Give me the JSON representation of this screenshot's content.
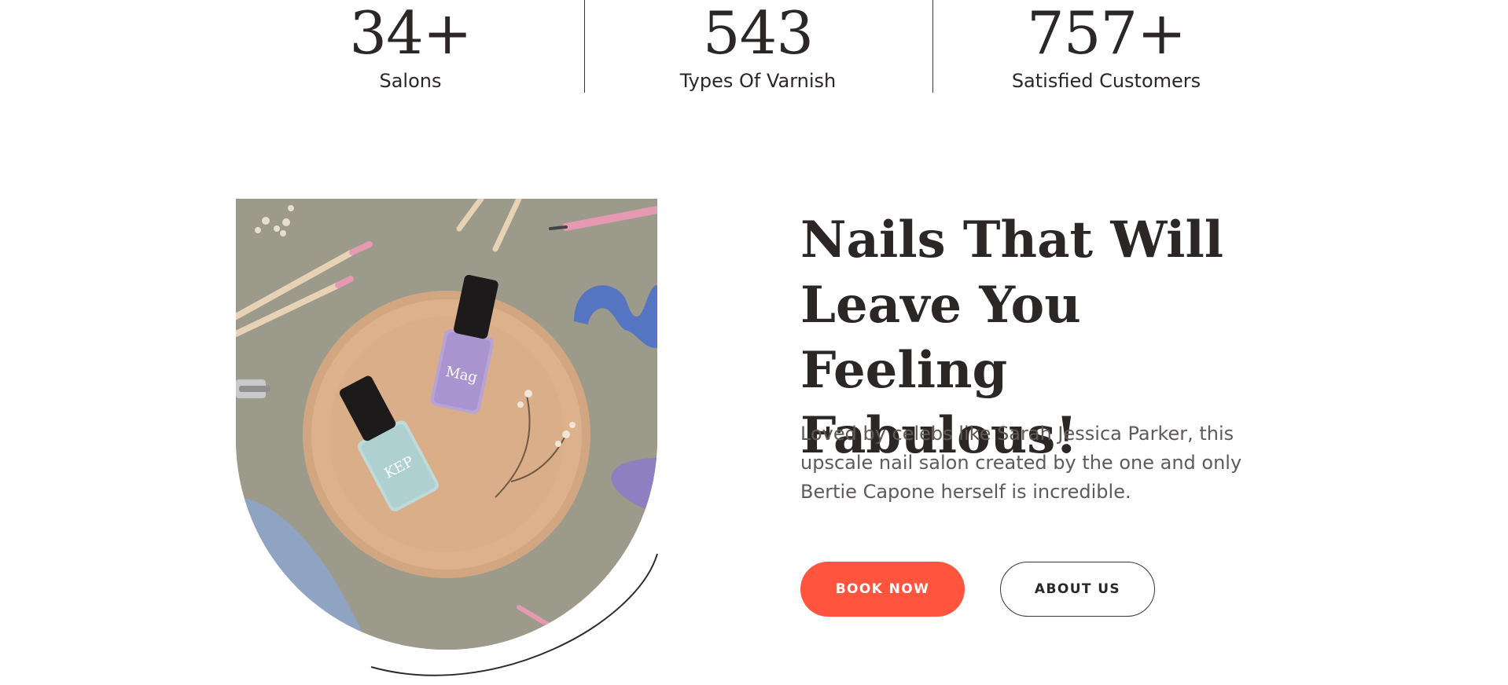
{
  "stats": [
    {
      "number": "34+",
      "label": "Salons"
    },
    {
      "number": "543",
      "label": "Types Of Varnish"
    },
    {
      "number": "757+",
      "label": "Satisfied Customers"
    }
  ],
  "hero": {
    "heading_line1": "Nails That Will",
    "heading_line2": "Leave You Feeling",
    "heading_line3": "Fabulous!",
    "description": "Loved by celebs like Sarah Jessica Parker, this upscale nail salon created by the one and only Bertie Capone herself is incredible.",
    "book_button": "BOOK NOW",
    "about_button": "ABOUT US"
  },
  "image": {
    "polish_label_purple": "Mag",
    "polish_label_mint": "KEP"
  },
  "colors": {
    "accent": "#ff553e",
    "text_dark": "#2b2726",
    "text_muted": "#5f5a59",
    "photo_background": "#9c9a8b"
  }
}
